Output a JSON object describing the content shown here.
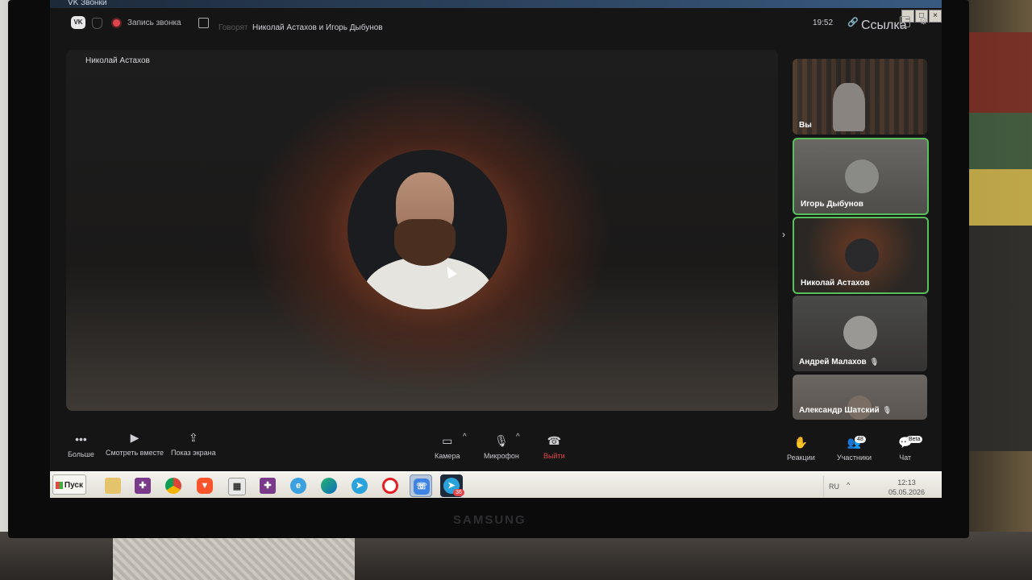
{
  "window": {
    "title": "VK Звонки",
    "controls": [
      "_",
      "□",
      "×"
    ]
  },
  "topbar": {
    "logo": "VK",
    "record_label": "Запись звонка",
    "speaking_label": "Говорят",
    "call_title": "Николай Астахов и Игорь Дыбунов",
    "time": "19:52",
    "link_label": "Ссылка"
  },
  "main_video": {
    "speaker_name": "Николай Астахов"
  },
  "participants": [
    {
      "name": "Вы",
      "muted": false,
      "active": false
    },
    {
      "name": "Игорь Дыбунов",
      "muted": false,
      "active": true
    },
    {
      "name": "Николай Астахов",
      "muted": false,
      "active": true
    },
    {
      "name": "Андрей Малахов",
      "muted": true,
      "active": false
    },
    {
      "name": "Александр Шатский",
      "muted": true,
      "active": false
    }
  ],
  "bottombar": {
    "more": "Больше",
    "watch_together": "Смотреть вместе",
    "screen_share": "Показ экрана",
    "camera": "Камера",
    "microphone": "Микрофон",
    "leave": "Выйти",
    "reactions": "Реакции",
    "participants": "Участники",
    "participants_count": "48",
    "chat": "Чат",
    "chat_badge": "Beta"
  },
  "taskbar": {
    "start": "Пуск",
    "telegram_badge": "36",
    "lang": "RU",
    "clock_time": "12:13",
    "clock_date": "05.05.2026"
  },
  "monitor": {
    "brand": "SAMSUNG"
  },
  "colors": {
    "accent_green": "#57c25a",
    "leave_red": "#e0454b",
    "record_red": "#e0454b"
  }
}
